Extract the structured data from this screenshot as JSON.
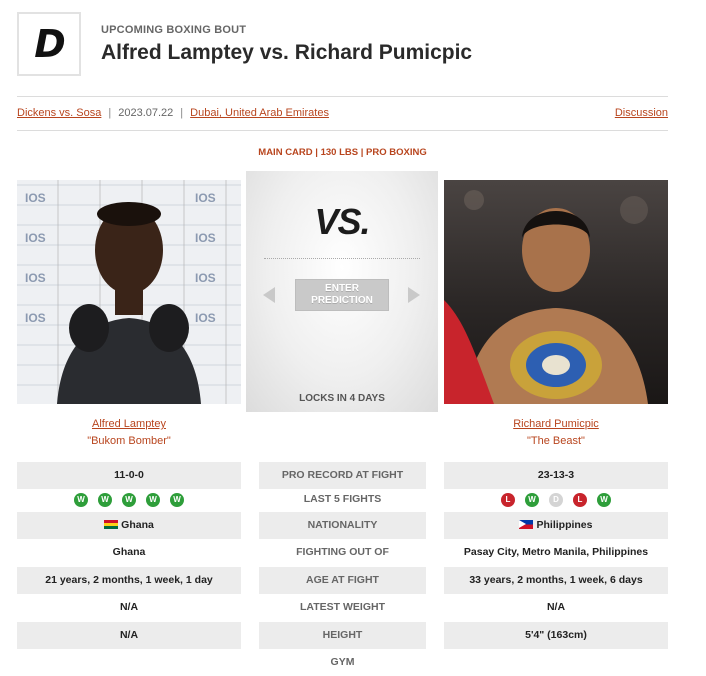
{
  "header": {
    "logo_letter": "D",
    "eyebrow": "UPCOMING BOXING BOUT",
    "title": "Alfred Lamptey vs. Richard Pumicpic"
  },
  "meta": {
    "event": "Dickens vs. Sosa",
    "date": "2023.07.22",
    "location": "Dubai, United Arab Emirates",
    "discussion": "Discussion"
  },
  "card_line": "MAIN CARD | 130 LBS | PRO BOXING",
  "center": {
    "vs": "VS.",
    "predict_line1": "ENTER",
    "predict_line2": "PREDICTION",
    "locks": "LOCKS IN 4 DAYS"
  },
  "fighters": {
    "left": {
      "name": "Alfred Lamptey",
      "nickname": "\"Bukom Bomber\""
    },
    "right": {
      "name": "Richard Pumicpic",
      "nickname": "\"The Beast\""
    }
  },
  "stats": {
    "record": {
      "label": "PRO RECORD AT FIGHT",
      "left": "11-0-0",
      "right": "23-13-3"
    },
    "last5": {
      "label": "LAST 5 FIGHTS",
      "left": [
        "W",
        "W",
        "W",
        "W",
        "W"
      ],
      "right": [
        "L",
        "W",
        "D",
        "L",
        "W"
      ]
    },
    "nationality": {
      "label": "NATIONALITY",
      "left": "Ghana",
      "right": "Philippines"
    },
    "fighting_out_of": {
      "label": "FIGHTING OUT OF",
      "left": "Ghana",
      "right": "Pasay City, Metro Manila, Philippines"
    },
    "age": {
      "label": "AGE AT FIGHT",
      "left": "21 years, 2 months, 1 week, 1 day",
      "right": "33 years, 2 months, 1 week, 6 days"
    },
    "weight": {
      "label": "LATEST WEIGHT",
      "left": "N/A",
      "right": "N/A"
    },
    "height": {
      "label": "HEIGHT",
      "left": "N/A",
      "right": "5'4\" (163cm)"
    },
    "gym": {
      "label": "GYM"
    }
  },
  "colors": {
    "accent": "#b8451e",
    "win": "#2e9e3a",
    "loss": "#c8242c",
    "draw": "#d4d4d4"
  },
  "icons": {
    "left_flag": "ghana-flag-icon",
    "right_flag": "philippines-flag-icon"
  }
}
